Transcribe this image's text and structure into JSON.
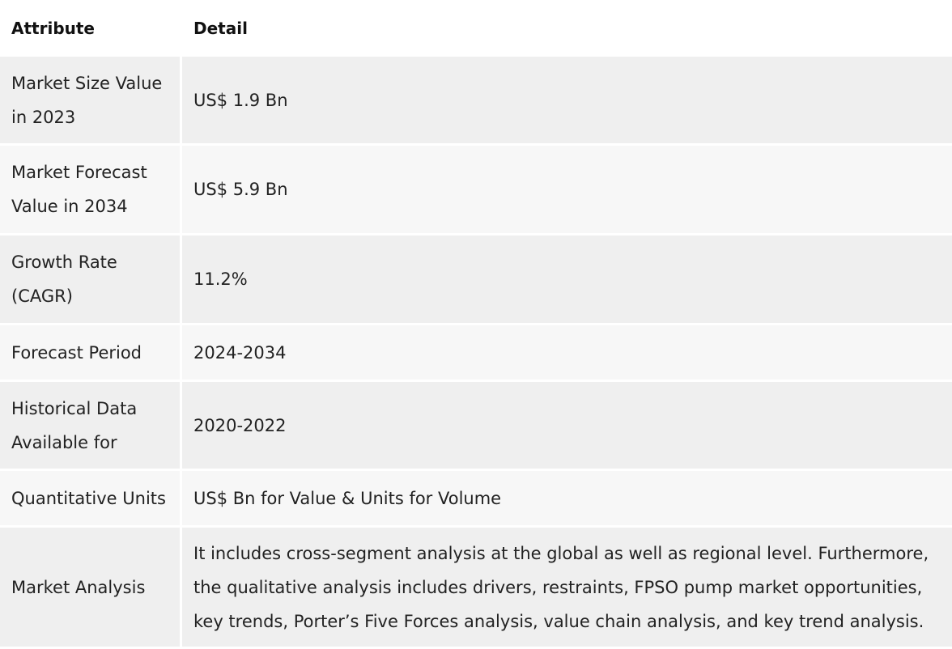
{
  "table": {
    "headers": {
      "attribute": "Attribute",
      "detail": "Detail"
    },
    "rows": [
      {
        "attribute": "Market Size Value in 2023",
        "detail": "US$ 1.9 Bn"
      },
      {
        "attribute": "Market Forecast Value in 2034",
        "detail": "US$ 5.9 Bn"
      },
      {
        "attribute": "Growth Rate (CAGR)",
        "detail": "11.2%"
      },
      {
        "attribute": "Forecast Period",
        "detail": "2024-2034"
      },
      {
        "attribute": "Historical Data Available for",
        "detail": "2020-2022"
      },
      {
        "attribute": "Quantitative Units",
        "detail": "US$ Bn for Value & Units for Volume"
      },
      {
        "attribute": "Market Analysis",
        "detail": "It includes cross-segment analysis at the global as well as regional level. Furthermore, the qualitative analysis includes drivers, restraints, FPSO pump market opportunities, key trends, Porter’s Five Forces analysis, value chain analysis, and key trend analysis."
      }
    ]
  }
}
